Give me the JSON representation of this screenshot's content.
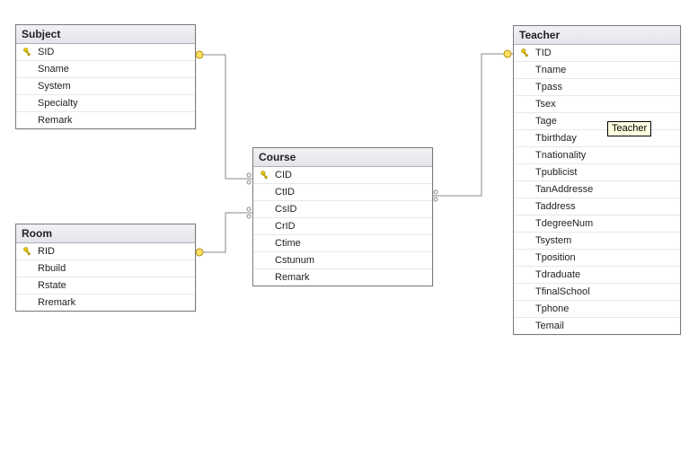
{
  "tables": {
    "subject": {
      "title": "Subject",
      "fields": [
        {
          "name": "SID",
          "pk": true
        },
        {
          "name": "Sname",
          "pk": false
        },
        {
          "name": "System",
          "pk": false
        },
        {
          "name": "Specialty",
          "pk": false
        },
        {
          "name": "Remark",
          "pk": false
        }
      ]
    },
    "room": {
      "title": "Room",
      "fields": [
        {
          "name": "RID",
          "pk": true
        },
        {
          "name": "Rbuild",
          "pk": false
        },
        {
          "name": "Rstate",
          "pk": false
        },
        {
          "name": "Rremark",
          "pk": false
        }
      ]
    },
    "course": {
      "title": "Course",
      "fields": [
        {
          "name": "CID",
          "pk": true
        },
        {
          "name": "CtID",
          "pk": false
        },
        {
          "name": "CsID",
          "pk": false
        },
        {
          "name": "CrID",
          "pk": false
        },
        {
          "name": "Ctime",
          "pk": false
        },
        {
          "name": "Cstunum",
          "pk": false
        },
        {
          "name": "Remark",
          "pk": false
        }
      ]
    },
    "teacher": {
      "title": "Teacher",
      "fields": [
        {
          "name": "TID",
          "pk": true
        },
        {
          "name": "Tname",
          "pk": false
        },
        {
          "name": "Tpass",
          "pk": false
        },
        {
          "name": "Tsex",
          "pk": false
        },
        {
          "name": "Tage",
          "pk": false
        },
        {
          "name": "Tbirthday",
          "pk": false
        },
        {
          "name": "Tnationality",
          "pk": false
        },
        {
          "name": "Tpublicist",
          "pk": false
        },
        {
          "name": "TanAddresse",
          "pk": false
        },
        {
          "name": "Taddress",
          "pk": false
        },
        {
          "name": "TdegreeNum",
          "pk": false
        },
        {
          "name": "Tsystem",
          "pk": false
        },
        {
          "name": "Tposition",
          "pk": false
        },
        {
          "name": "Tdraduate",
          "pk": false
        },
        {
          "name": "TfinalSchool",
          "pk": false
        },
        {
          "name": "Tphone",
          "pk": false
        },
        {
          "name": "Temail",
          "pk": false
        }
      ]
    }
  },
  "tooltip": {
    "text": "Teacher"
  },
  "relationships": [
    {
      "from": "course",
      "to": "subject"
    },
    {
      "from": "course",
      "to": "room"
    },
    {
      "from": "course",
      "to": "teacher"
    }
  ]
}
